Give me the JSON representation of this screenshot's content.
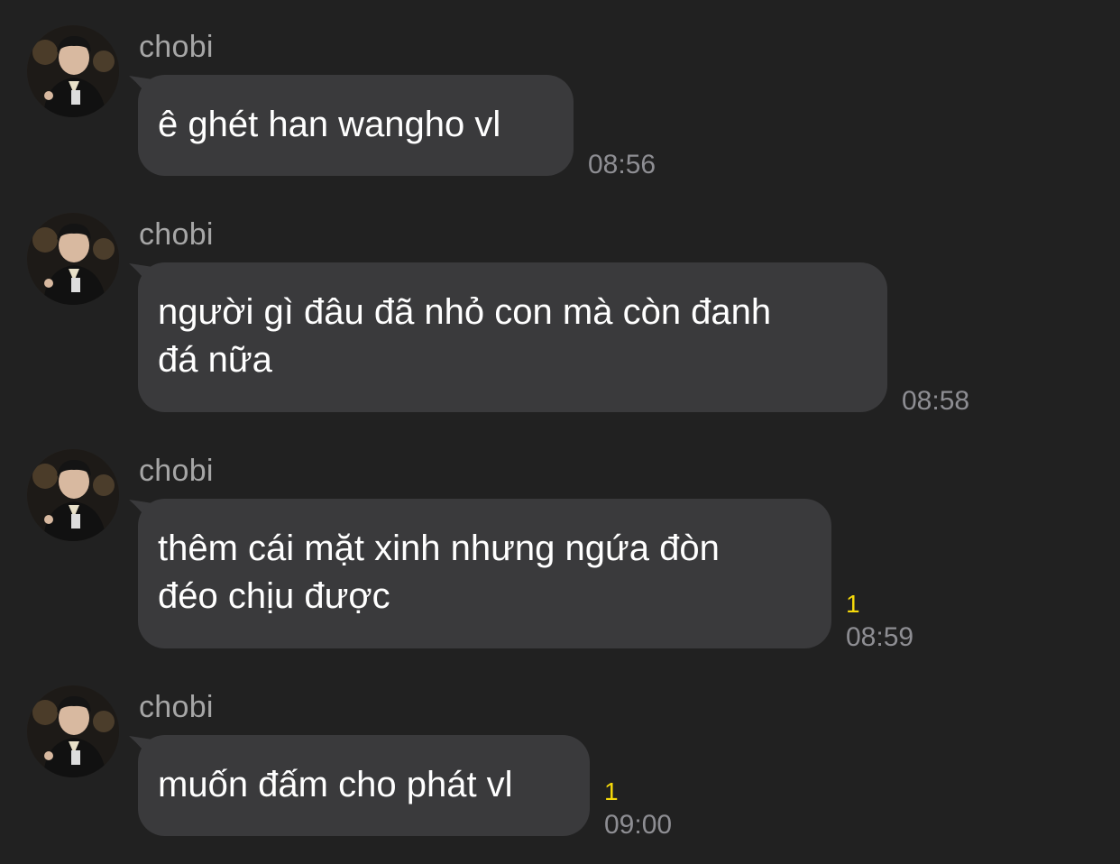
{
  "messages": [
    {
      "sender": "chobi",
      "text": "ê ghét han wangho vl",
      "time": "08:56",
      "unread": ""
    },
    {
      "sender": "chobi",
      "text": "người gì đâu đã nhỏ con mà còn đanh\nđá nữa",
      "time": "08:58",
      "unread": ""
    },
    {
      "sender": "chobi",
      "text": "thêm cái mặt xinh nhưng ngứa đòn\nđéo chịu được",
      "time": "08:59",
      "unread": "1"
    },
    {
      "sender": "chobi",
      "text": "muốn đấm cho phát vl",
      "time": "09:00",
      "unread": "1"
    }
  ],
  "colors": {
    "background": "#212121",
    "bubble": "#3a3a3c",
    "unread": "#f5d90a",
    "time": "#8e8e93",
    "sender": "#a6a6a6"
  }
}
